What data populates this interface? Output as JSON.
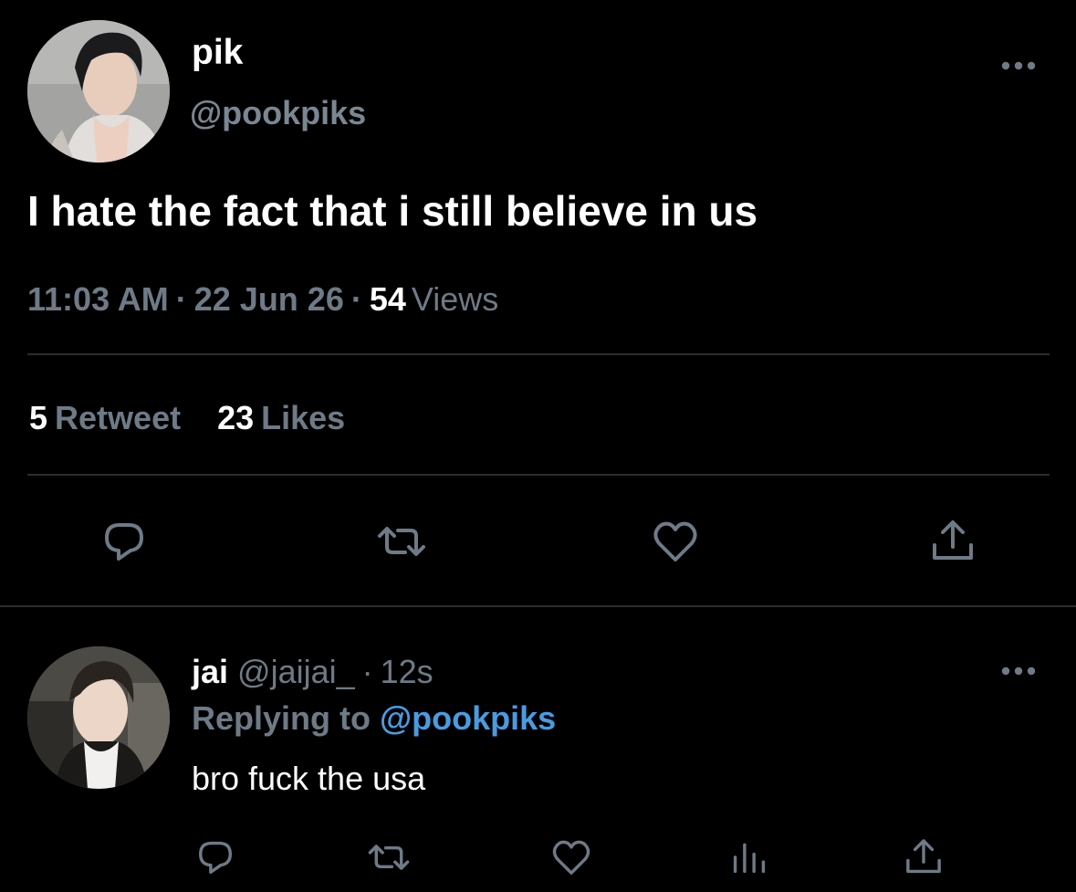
{
  "colors": {
    "background": "#000000",
    "text_primary": "#ffffff",
    "text_secondary": "#6e7a86",
    "link": "#4a9be0",
    "divider": "#2a2d30"
  },
  "tweet": {
    "author": {
      "display_name": "pik",
      "handle": "@pookpiks",
      "avatar_icon": "profile-photo"
    },
    "text": "I hate the fact that i still believe in us",
    "time": "11:03 AM",
    "date": "22 Jun 26",
    "separator": "·",
    "views_count": "54",
    "views_label": "Views",
    "retweet_count": "5",
    "retweet_label": "Retweet",
    "likes_count": "23",
    "likes_label": "Likes",
    "actions": [
      "reply-icon",
      "retweet-icon",
      "like-icon",
      "share-icon"
    ]
  },
  "reply": {
    "author": {
      "display_name": "jai",
      "handle": "@jaijai_",
      "avatar_icon": "profile-photo"
    },
    "separator": "·",
    "age": "12s",
    "replying_label": "Replying to",
    "replying_mention": "@pookpiks",
    "text": "bro fuck the usa",
    "actions": [
      "reply-icon",
      "retweet-icon",
      "like-icon",
      "analytics-icon",
      "share-icon"
    ]
  }
}
